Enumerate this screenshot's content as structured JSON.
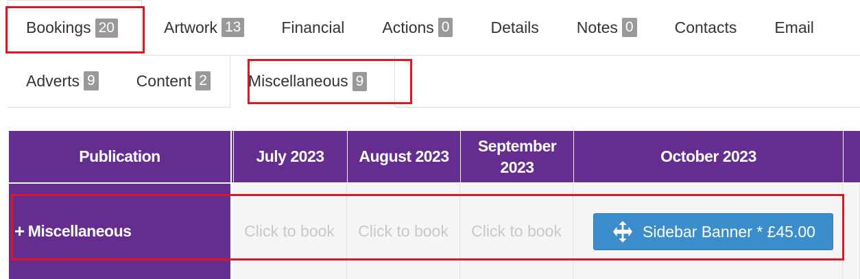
{
  "tabs_row1": [
    {
      "label": "Bookings",
      "count": "20"
    },
    {
      "label": "Artwork",
      "count": "13"
    },
    {
      "label": "Financial",
      "count": ""
    },
    {
      "label": "Actions",
      "count": "0"
    },
    {
      "label": "Details",
      "count": ""
    },
    {
      "label": "Notes",
      "count": "0"
    },
    {
      "label": "Contacts",
      "count": ""
    },
    {
      "label": "Email",
      "count": ""
    }
  ],
  "tabs_row2": [
    {
      "label": "Adverts",
      "count": "9"
    },
    {
      "label": "Content",
      "count": "2"
    },
    {
      "label": "Miscellaneous",
      "count": "9"
    }
  ],
  "grid": {
    "header": {
      "publication": "Publication",
      "months": [
        "July 2023",
        "August 2023",
        "September 2023",
        "October 2023"
      ]
    },
    "row": {
      "expand_symbol": "+",
      "publication": "Miscellaneous",
      "empty_cell_label": "Click to book",
      "booking_label": "Sidebar Banner * £45.00",
      "booking_icon": "move-arrows-icon"
    }
  },
  "colors": {
    "header_bg": "#662d91",
    "highlight": "#e0151d",
    "booking_button": "#3c8dcc",
    "badge": "#999999"
  }
}
